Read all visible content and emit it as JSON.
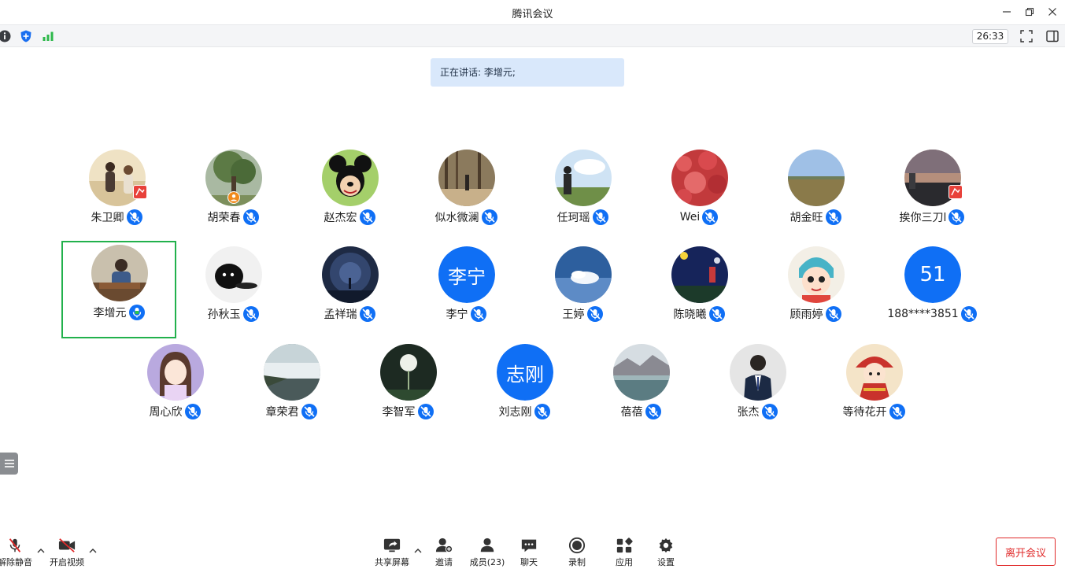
{
  "window": {
    "title": "腾讯会议"
  },
  "infobar": {
    "timer": "26:33"
  },
  "speaking": {
    "text": "正在讲话: 李增元;"
  },
  "participants": [
    {
      "name": "朱卫卿",
      "avatar": "photo-couple"
    },
    {
      "name": "胡荣春",
      "avatar": "photo-tree"
    },
    {
      "name": "赵杰宏",
      "avatar": "photo-mickey"
    },
    {
      "name": "似水微澜",
      "avatar": "photo-woods"
    },
    {
      "name": "任珂瑶",
      "avatar": "photo-sky-person"
    },
    {
      "name": "Wei",
      "avatar": "photo-red-flowers"
    },
    {
      "name": "胡金旺",
      "avatar": "photo-grassland"
    },
    {
      "name": "挨你三刀l",
      "avatar": "photo-sunset"
    },
    {
      "name": "李增元",
      "avatar": "photo-man-desk"
    },
    {
      "name": "孙秋玉",
      "avatar": "photo-black-cat"
    },
    {
      "name": "孟祥瑞",
      "avatar": "photo-night-sky"
    },
    {
      "name": "李宁",
      "avatar_text": "李宁"
    },
    {
      "name": "王婷",
      "avatar": "photo-clouds"
    },
    {
      "name": "陈晓曦",
      "avatar": "photo-night-boy"
    },
    {
      "name": "顾雨婷",
      "avatar": "photo-cartoon-girl"
    },
    {
      "name": "188****3851",
      "avatar_text": "51"
    },
    {
      "name": "周心欣",
      "avatar": "photo-anime-girl"
    },
    {
      "name": "章荣君",
      "avatar": "photo-waterfall"
    },
    {
      "name": "李智军",
      "avatar": "photo-dandelion"
    },
    {
      "name": "刘志刚",
      "avatar_text": "志刚"
    },
    {
      "name": "蓓蓓",
      "avatar": "photo-lake"
    },
    {
      "name": "张杰",
      "avatar": "photo-suit-man"
    },
    {
      "name": "等待花开",
      "avatar": "photo-cartoon-red"
    }
  ],
  "toolbar": {
    "unmute": "解除静音",
    "video": "开启视频",
    "share": "共享屏幕",
    "invite": "邀请",
    "members": "成员(23)",
    "chat": "聊天",
    "record": "录制",
    "apps": "应用",
    "settings": "设置",
    "leave": "离开会议"
  },
  "colors": {
    "accent": "#0f6ff5",
    "active_border": "#22b14c",
    "leave": "#e02b2b",
    "banner": "#d9e8fb"
  }
}
